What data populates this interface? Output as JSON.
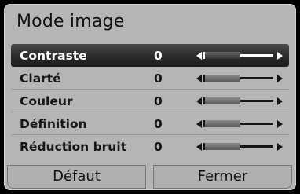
{
  "dialog": {
    "title": "Mode image"
  },
  "settings": [
    {
      "label": "Contraste",
      "value": "0",
      "level": 0.5
    },
    {
      "label": "Clarté",
      "value": "0",
      "level": 0.5
    },
    {
      "label": "Couleur",
      "value": "0",
      "level": 0.5
    },
    {
      "label": "Définition",
      "value": "0",
      "level": 0.5
    },
    {
      "label": "Réduction bruit",
      "value": "0",
      "level": 0.5
    }
  ],
  "selected_index": 0,
  "buttons": {
    "default_label": "Défaut",
    "close_label": "Fermer"
  }
}
